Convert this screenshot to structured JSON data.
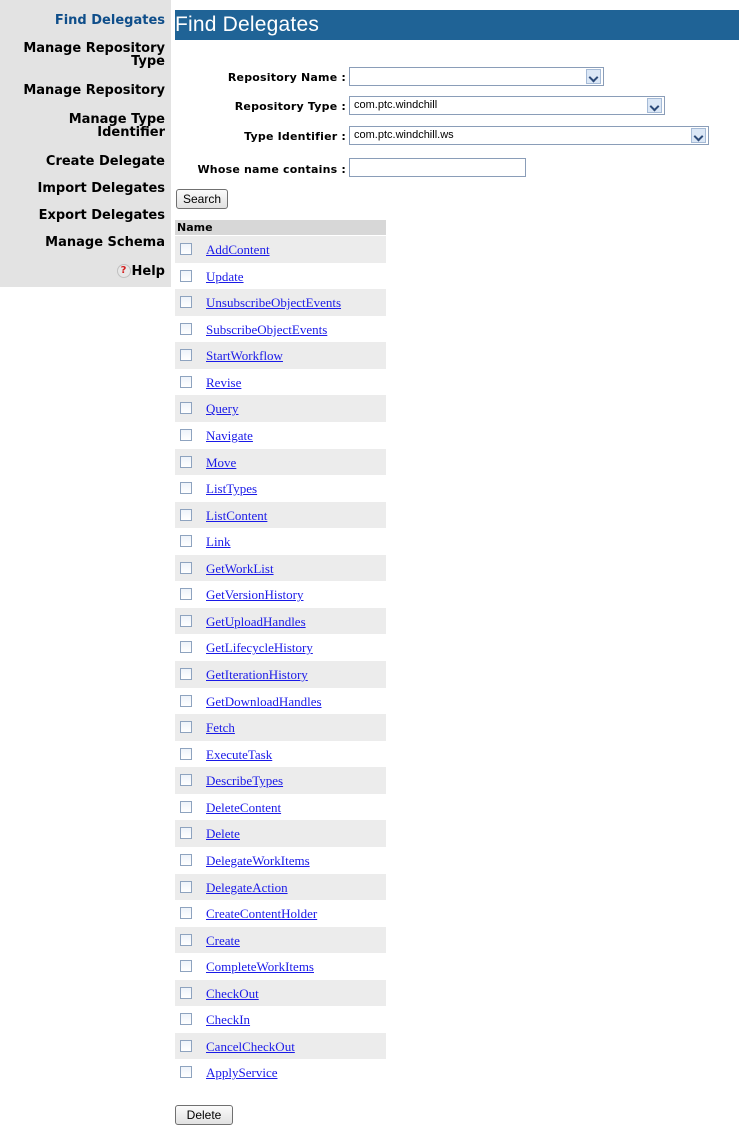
{
  "sidebar": {
    "items": [
      {
        "label": "Find Delegates",
        "active": true
      },
      {
        "label": "Manage Repository",
        "label2": "Type"
      },
      {
        "label": "Manage Repository"
      },
      {
        "label": "Manage Type",
        "label2": "Identifier"
      },
      {
        "label": "Create Delegate"
      },
      {
        "label": "Import Delegates"
      },
      {
        "label": "Export Delegates"
      },
      {
        "label": "Manage Schema"
      }
    ],
    "help": {
      "icon": "help-icon",
      "icon_glyph": "?",
      "label": "Help"
    }
  },
  "main": {
    "title": "Find Delegates",
    "form": {
      "repository_name_label": "Repository Name :",
      "repository_name_value": "",
      "repository_type_label": "Repository Type :",
      "repository_type_value": "com.ptc.windchill",
      "type_identifier_label": "Type Identifier :",
      "type_identifier_value": "com.ptc.windchill.ws",
      "whose_name_label": "Whose name contains :",
      "whose_name_value": "",
      "search_button": "Search"
    },
    "results": {
      "column_header": "Name",
      "rows": [
        "AddContent",
        "Update",
        "UnsubscribeObjectEvents",
        "SubscribeObjectEvents",
        "StartWorkflow",
        "Revise",
        "Query",
        "Navigate",
        "Move",
        "ListTypes",
        "ListContent",
        "Link",
        "GetWorkList",
        "GetVersionHistory",
        "GetUploadHandles",
        "GetLifecycleHistory",
        "GetIterationHistory",
        "GetDownloadHandles",
        "Fetch",
        "ExecuteTask",
        "DescribeTypes",
        "DeleteContent",
        "Delete",
        "DelegateWorkItems",
        "DelegateAction",
        "CreateContentHolder",
        "Create",
        "CompleteWorkItems",
        "CheckOut",
        "CheckIn",
        "CancelCheckOut",
        "ApplyService"
      ]
    },
    "delete_button": "Delete"
  },
  "colors": {
    "title_bar": "#1f6396",
    "sidebar_bg": "#e3e3e3",
    "active_nav": "#0f4e8a",
    "link": "#1a1ae8",
    "row_shade": "#ececec",
    "header_bg": "#d7d7d7"
  }
}
